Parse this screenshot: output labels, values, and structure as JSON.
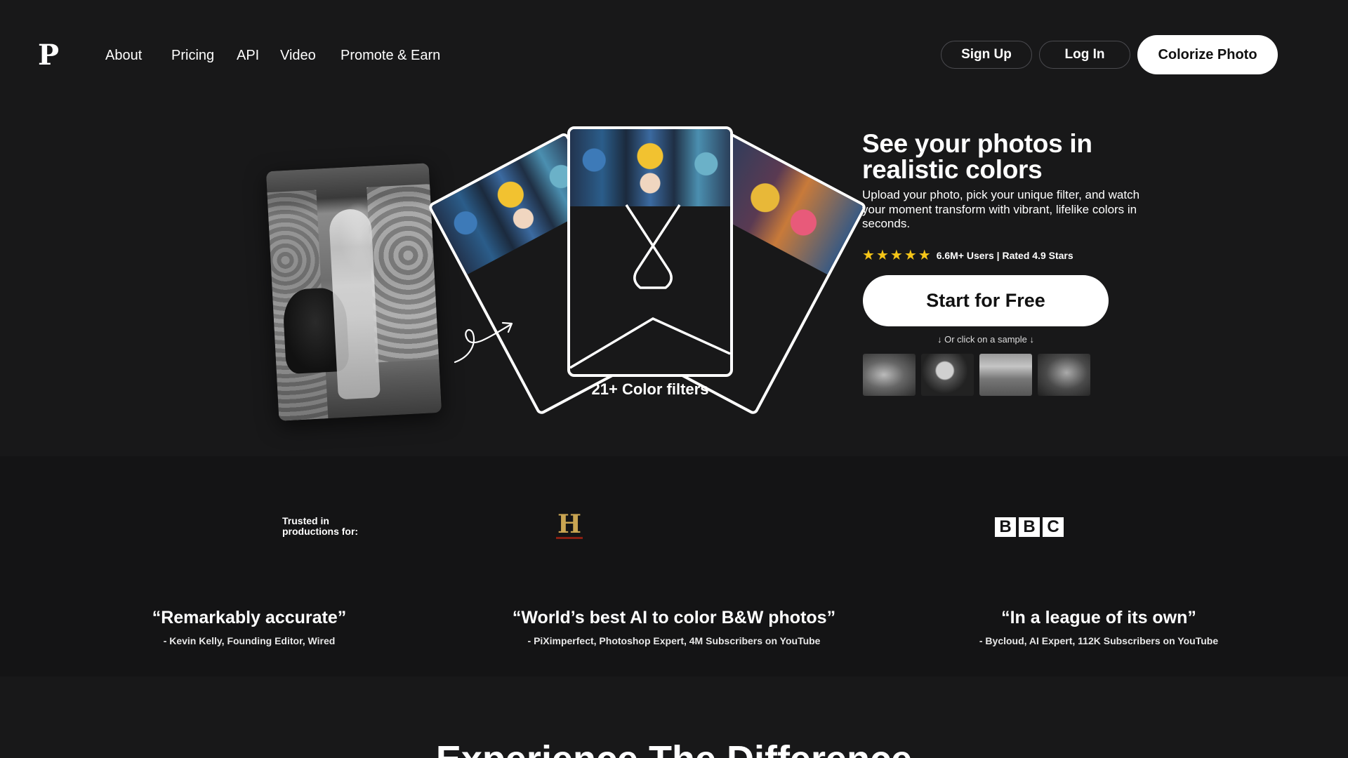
{
  "nav": {
    "logo": "P",
    "links": [
      "About",
      "Pricing",
      "API",
      "Video",
      "Promote & Earn"
    ],
    "sign_up": "Sign Up",
    "log_in": "Log In",
    "colorize": "Colorize Photo"
  },
  "hero": {
    "fan_caption": "21+ Color filters",
    "title": "See your photos in realistic colors",
    "subtitle": "Upload your photo, pick your unique filter, and watch your moment transform with vibrant, lifelike colors in seconds.",
    "rating_stars": 5,
    "rating_text": "6.6M+ Users | Rated 4.9 Stars",
    "cta": "Start for Free",
    "sample_hint": "↓ Or click on a sample ↓"
  },
  "trust": {
    "label": "Trusted in productions for:",
    "history_logo": "H",
    "bbc_letters": [
      "B",
      "B",
      "C"
    ]
  },
  "quotes": [
    {
      "text": "“Remarkably accurate”",
      "by": "- Kevin Kelly, Founding Editor, Wired"
    },
    {
      "text": "“World’s best AI to color B&W photos”",
      "by": "- PiXimperfect, Photoshop Expert, 4M Subscribers on YouTube"
    },
    {
      "text": "“In a league of its own”",
      "by": "- Bycloud, AI Expert, 112K Subscribers on YouTube"
    }
  ],
  "bottom": {
    "heading": "Experience The Difference"
  },
  "colors": {
    "background": "#181819",
    "band": "#141415",
    "star": "#f5c518",
    "button_bg": "#ffffff"
  }
}
